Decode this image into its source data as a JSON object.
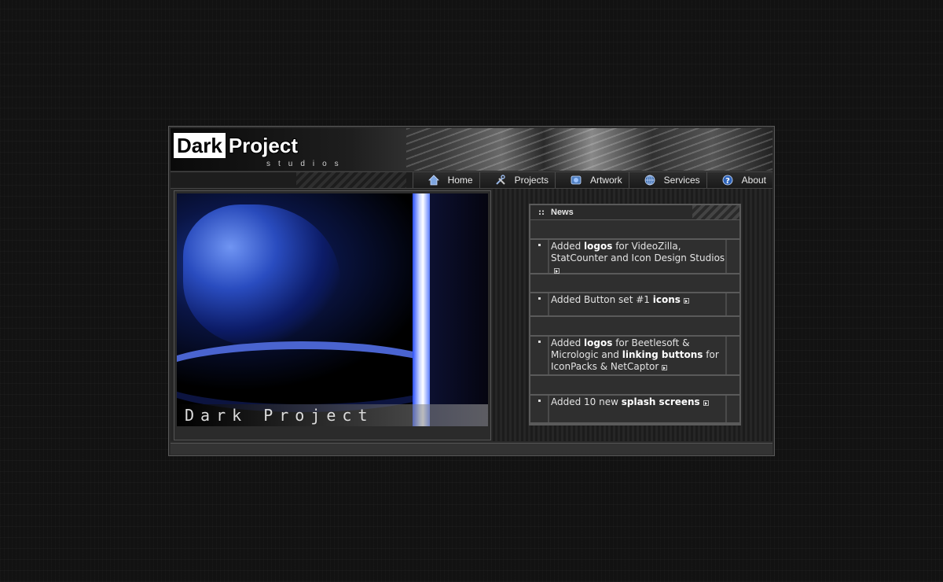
{
  "site": {
    "logo_dark": "Dark",
    "logo_project": "Project",
    "logo_sub": "studios"
  },
  "nav": [
    {
      "label": "Home",
      "icon": "home-icon"
    },
    {
      "label": "Projects",
      "icon": "tools-icon"
    },
    {
      "label": "Artwork",
      "icon": "artwork-icon"
    },
    {
      "label": "Services",
      "icon": "globe-icon"
    },
    {
      "label": "About",
      "icon": "help-icon"
    }
  ],
  "hero": {
    "caption": "Dark Project"
  },
  "news": {
    "title": "News",
    "items": [
      {
        "parts": [
          "Added ",
          "logos",
          " for VideoZilla, StatCounter and Icon Design Studios"
        ]
      },
      {
        "parts": [
          "Added Button set #1 ",
          "icons",
          ""
        ]
      },
      {
        "parts": [
          "Added ",
          "logos",
          " for Beetlesoft & Micrologic and ",
          "linking buttons",
          " for IconPacks & NetCaptor"
        ]
      },
      {
        "parts": [
          "Added 10 new ",
          "splash screens",
          ""
        ]
      }
    ]
  },
  "colors": {
    "background": "#121212",
    "frame": "#2a2a2a",
    "accent_blue": "#2a4fff"
  }
}
